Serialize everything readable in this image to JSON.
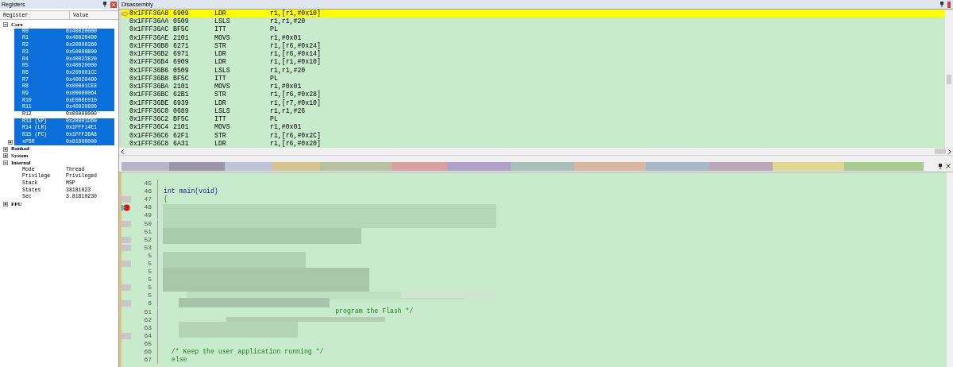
{
  "registers": {
    "title": "Registers",
    "columns": [
      "Register",
      "Value"
    ],
    "tree": [
      {
        "name": "Core",
        "expanded": true,
        "children": [
          {
            "name": "R0",
            "value": "0x40020000",
            "selected": true
          },
          {
            "name": "R1",
            "value": "0x40020400",
            "selected": true
          },
          {
            "name": "R2",
            "value": "0x20000360",
            "selected": true
          },
          {
            "name": "R3",
            "value": "0x50000B00",
            "selected": true
          },
          {
            "name": "R4",
            "value": "0x40023820",
            "selected": true
          },
          {
            "name": "R5",
            "value": "0x40020000",
            "selected": true
          },
          {
            "name": "R6",
            "value": "0x200001CC",
            "selected": true
          },
          {
            "name": "R7",
            "value": "0x40020400",
            "selected": true
          },
          {
            "name": "R8",
            "value": "0x00001CE8",
            "selected": true
          },
          {
            "name": "R9",
            "value": "0x00000064",
            "selected": true
          },
          {
            "name": "R10",
            "value": "0xE000E010",
            "selected": true
          },
          {
            "name": "R11",
            "value": "0x40020800",
            "selected": true
          },
          {
            "name": "R12",
            "value": "0x00000000",
            "selected": false
          },
          {
            "name": "R13 (SP)",
            "value": "0x20001D60",
            "selected": true
          },
          {
            "name": "R14 (LR)",
            "value": "0x1FFF14E1",
            "selected": true
          },
          {
            "name": "R15 (PC)",
            "value": "0x1FFF36A8",
            "selected": true
          },
          {
            "name": "xPSR",
            "value": "0x81000000",
            "selected": true,
            "expanded": false
          }
        ]
      },
      {
        "name": "Banked",
        "expanded": false
      },
      {
        "name": "System",
        "expanded": false
      },
      {
        "name": "Internal",
        "expanded": true,
        "children": [
          {
            "name": "Mode",
            "value": "Thread",
            "selected": false
          },
          {
            "name": "Privilege",
            "value": "Privileged",
            "selected": false
          },
          {
            "name": "Stack",
            "value": "MSP",
            "selected": false
          },
          {
            "name": "States",
            "value": "38181023",
            "selected": false
          },
          {
            "name": "Sec",
            "value": "3.81810230",
            "selected": false
          }
        ]
      },
      {
        "name": "FPU",
        "expanded": false
      }
    ]
  },
  "disassembly": {
    "title": "Disassembly",
    "rows": [
      {
        "address": "0x1FFF36A8",
        "opcode": "6909",
        "mnemonic": "LDR",
        "operands": "r1,[r1,#0x10]",
        "current": true
      },
      {
        "address": "0x1FFF36AA",
        "opcode": "0509",
        "mnemonic": "LSLS",
        "operands": "r1,r1,#20",
        "current": false
      },
      {
        "address": "0x1FFF36AC",
        "opcode": "BF5C",
        "mnemonic": "ITT",
        "operands": "PL",
        "current": false
      },
      {
        "address": "0x1FFF36AE",
        "opcode": "2101",
        "mnemonic": "MOVS",
        "operands": "r1,#0x01",
        "current": false
      },
      {
        "address": "0x1FFF36B0",
        "opcode": "6271",
        "mnemonic": "STR",
        "operands": "r1,[r6,#0x24]",
        "current": false
      },
      {
        "address": "0x1FFF36B2",
        "opcode": "6971",
        "mnemonic": "LDR",
        "operands": "r1,[r6,#0x14]",
        "current": false
      },
      {
        "address": "0x1FFF36B4",
        "opcode": "6909",
        "mnemonic": "LDR",
        "operands": "r1,[r1,#0x10]",
        "current": false
      },
      {
        "address": "0x1FFF36B6",
        "opcode": "0509",
        "mnemonic": "LSLS",
        "operands": "r1,r1,#20",
        "current": false
      },
      {
        "address": "0x1FFF36B8",
        "opcode": "BF5C",
        "mnemonic": "ITT",
        "operands": "PL",
        "current": false
      },
      {
        "address": "0x1FFF36BA",
        "opcode": "2101",
        "mnemonic": "MOVS",
        "operands": "r1,#0x01",
        "current": false
      },
      {
        "address": "0x1FFF36BC",
        "opcode": "62B1",
        "mnemonic": "STR",
        "operands": "r1,[r6,#0x28]",
        "current": false
      },
      {
        "address": "0x1FFF36BE",
        "opcode": "6939",
        "mnemonic": "LDR",
        "operands": "r1,[r7,#0x10]",
        "current": false
      },
      {
        "address": "0x1FFF36C0",
        "opcode": "0689",
        "mnemonic": "LSLS",
        "operands": "r1,r1,#26",
        "current": false
      },
      {
        "address": "0x1FFF36C2",
        "opcode": "BF5C",
        "mnemonic": "ITT",
        "operands": "PL",
        "current": false
      },
      {
        "address": "0x1FFF36C4",
        "opcode": "2101",
        "mnemonic": "MOVS",
        "operands": "r1,#0x01",
        "current": false
      },
      {
        "address": "0x1FFF36C6",
        "opcode": "62F1",
        "mnemonic": "STR",
        "operands": "r1,[r6,#0x2C]",
        "current": false
      },
      {
        "address": "0x1FFF36C8",
        "opcode": "6A31",
        "mnemonic": "LDR",
        "operands": "r1,[r6,#0x20]",
        "current": false
      }
    ]
  },
  "source": {
    "lines": [
      {
        "number": "45",
        "executable": false,
        "breakpoint": false
      },
      {
        "number": "46",
        "code": "int main(void)",
        "executable": false,
        "breakpoint": false
      },
      {
        "number": "47",
        "code": "{",
        "executable": true,
        "breakpoint": false
      },
      {
        "number": "48",
        "breakpoint": true
      },
      {
        "number": "49",
        "executable": false,
        "breakpoint": false
      },
      {
        "number": "50",
        "executable": true,
        "breakpoint": false
      },
      {
        "number": "51",
        "executable": false,
        "breakpoint": false
      },
      {
        "number": "52",
        "executable": true,
        "breakpoint": false
      },
      {
        "number": "53",
        "executable": true,
        "breakpoint": false
      },
      {
        "number": "5",
        "executable": false,
        "breakpoint": false
      },
      {
        "number": "5",
        "executable": true,
        "breakpoint": false
      },
      {
        "number": "5",
        "executable": false,
        "breakpoint": false
      },
      {
        "number": "5",
        "executable": false,
        "breakpoint": false
      },
      {
        "number": "5",
        "executable": true,
        "breakpoint": false
      },
      {
        "number": "5",
        "executable": false,
        "breakpoint": false
      },
      {
        "number": "6",
        "executable": true,
        "breakpoint": false
      },
      {
        "number": "61",
        "code": "                                            program the Flash */",
        "executable": false,
        "breakpoint": false
      },
      {
        "number": "62",
        "executable": false,
        "breakpoint": false
      },
      {
        "number": "63",
        "executable": false,
        "breakpoint": false
      },
      {
        "number": "64",
        "executable": true,
        "breakpoint": false
      },
      {
        "number": "65",
        "executable": false,
        "breakpoint": false
      },
      {
        "number": "66",
        "code": "  /* Keep the user application running */",
        "executable": false,
        "breakpoint": false
      },
      {
        "number": "67",
        "code": "  else",
        "executable": false,
        "breakpoint": false
      }
    ]
  }
}
